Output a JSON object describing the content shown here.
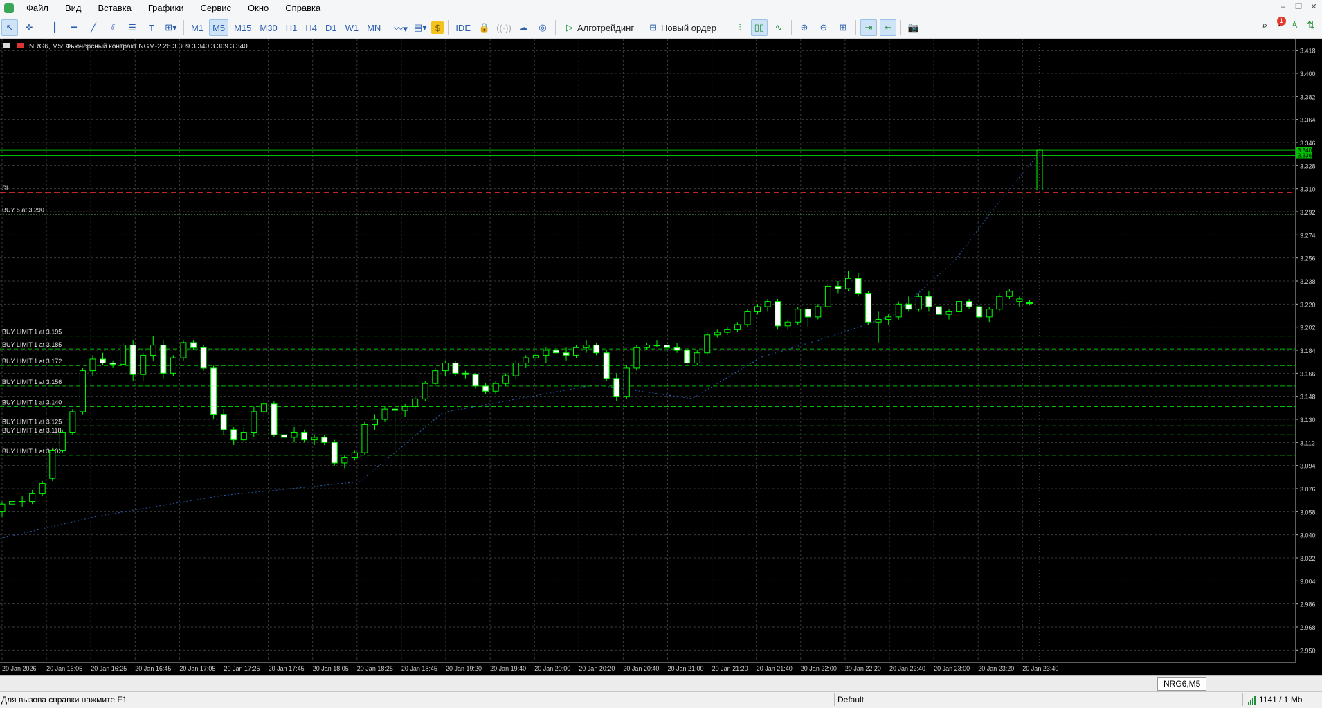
{
  "menu": [
    "Файл",
    "Вид",
    "Вставка",
    "Графики",
    "Сервис",
    "Окно",
    "Справка"
  ],
  "toolbar": {
    "timeframes": [
      "M1",
      "M5",
      "M15",
      "M30",
      "H1",
      "H4",
      "D1",
      "W1",
      "MN"
    ],
    "active_timeframe": "M5",
    "ide_label": "IDE",
    "algotrading_label": "Алготрейдинг",
    "new_order_label": "Новый ордер",
    "notification_count": "1"
  },
  "chart": {
    "header": "NRG6, M5:  Фьючерсный контракт NGM-2.26  3.309 3.340 3.309 3.340",
    "background": "#000000",
    "bull_color": "#00ff00",
    "bear_color": "#ffffff",
    "grid_color": "#3a3a3a",
    "level_color": "#00c000",
    "sl_color": "#ff3333",
    "price_labels": [
      "3.418",
      "3.400",
      "3.382",
      "3.364",
      "3.346",
      "3.328",
      "3.310",
      "3.292",
      "3.274",
      "3.256",
      "3.238",
      "3.220",
      "3.202",
      "3.184",
      "3.166",
      "3.148",
      "3.130",
      "3.112",
      "3.094",
      "3.076",
      "3.058",
      "3.040",
      "3.022",
      "3.004",
      "2.986",
      "2.968",
      "2.950"
    ],
    "current_price_labels": [
      "3.340",
      "3.336"
    ],
    "time_labels": [
      "20 Jan 2026",
      "20 Jan 16:05",
      "20 Jan 16:25",
      "20 Jan 16:45",
      "20 Jan 17:05",
      "20 Jan 17:25",
      "20 Jan 17:45",
      "20 Jan 18:05",
      "20 Jan 18:25",
      "20 Jan 18:45",
      "20 Jan 19:20",
      "20 Jan 19:40",
      "20 Jan 20:00",
      "20 Jan 20:20",
      "20 Jan 20:40",
      "20 Jan 21:00",
      "20 Jan 21:20",
      "20 Jan 21:40",
      "20 Jan 22:00",
      "20 Jan 22:20",
      "20 Jan 22:40",
      "20 Jan 23:00",
      "20 Jan 23:20",
      "20 Jan 23:40"
    ],
    "levels": [
      {
        "label": "SL",
        "price": 3.307,
        "kind": "sl"
      },
      {
        "label": "BUY 5 at 3.290",
        "price": 3.29,
        "kind": "solid"
      },
      {
        "label": "BUY LIMIT 1 at 3.195",
        "price": 3.195,
        "kind": "limit"
      },
      {
        "label": "BUY LIMIT 1 at 3.185",
        "price": 3.185,
        "kind": "limit"
      },
      {
        "label": "BUY LIMIT 1 at 3.172",
        "price": 3.172,
        "kind": "limit"
      },
      {
        "label": "BUY LIMIT 1 at 3.156",
        "price": 3.156,
        "kind": "limit"
      },
      {
        "label": "BUY LIMIT 1 at 3.140",
        "price": 3.14,
        "kind": "limit"
      },
      {
        "label": "BUY LIMIT 1 at 3.125",
        "price": 3.125,
        "kind": "limit"
      },
      {
        "label": "BUY LIMIT 1 at 3.118",
        "price": 3.118,
        "kind": "limit"
      },
      {
        "label": "BUY LIMIT 1 at 3.102",
        "price": 3.102,
        "kind": "limit"
      }
    ],
    "current_levels": [
      3.34,
      3.336
    ],
    "chart_data": {
      "type": "candlestick",
      "symbol": "NRG6",
      "timeframe": "M5",
      "ylim": [
        2.941,
        3.427
      ],
      "candles": [
        [
          3.058,
          3.066,
          3.054,
          3.064
        ],
        [
          3.064,
          3.068,
          3.06,
          3.066
        ],
        [
          3.066,
          3.07,
          3.062,
          3.066
        ],
        [
          3.066,
          3.075,
          3.064,
          3.072
        ],
        [
          3.072,
          3.082,
          3.07,
          3.08
        ],
        [
          3.084,
          3.108,
          3.082,
          3.106
        ],
        [
          3.106,
          3.122,
          3.104,
          3.12
        ],
        [
          3.12,
          3.138,
          3.118,
          3.136
        ],
        [
          3.136,
          3.17,
          3.134,
          3.168
        ],
        [
          3.168,
          3.18,
          3.164,
          3.177
        ],
        [
          3.177,
          3.182,
          3.172,
          3.174
        ],
        [
          3.174,
          3.176,
          3.17,
          3.173
        ],
        [
          3.173,
          3.19,
          3.172,
          3.188
        ],
        [
          3.188,
          3.192,
          3.16,
          3.165
        ],
        [
          3.165,
          3.182,
          3.16,
          3.18
        ],
        [
          3.18,
          3.195,
          3.176,
          3.188
        ],
        [
          3.188,
          3.192,
          3.162,
          3.166
        ],
        [
          3.166,
          3.18,
          3.164,
          3.178
        ],
        [
          3.178,
          3.192,
          3.176,
          3.19
        ],
        [
          3.19,
          3.192,
          3.184,
          3.186
        ],
        [
          3.186,
          3.188,
          3.168,
          3.17
        ],
        [
          3.17,
          3.172,
          3.13,
          3.134
        ],
        [
          3.134,
          3.138,
          3.118,
          3.122
        ],
        [
          3.122,
          3.124,
          3.11,
          3.114
        ],
        [
          3.114,
          3.124,
          3.112,
          3.12
        ],
        [
          3.12,
          3.14,
          3.116,
          3.136
        ],
        [
          3.136,
          3.146,
          3.132,
          3.142
        ],
        [
          3.142,
          3.144,
          3.116,
          3.118
        ],
        [
          3.118,
          3.122,
          3.112,
          3.116
        ],
        [
          3.116,
          3.124,
          3.112,
          3.12
        ],
        [
          3.12,
          3.122,
          3.112,
          3.114
        ],
        [
          3.114,
          3.118,
          3.11,
          3.116
        ],
        [
          3.116,
          3.118,
          3.11,
          3.112
        ],
        [
          3.112,
          3.114,
          3.094,
          3.096
        ],
        [
          3.096,
          3.102,
          3.092,
          3.1
        ],
        [
          3.1,
          3.106,
          3.098,
          3.104
        ],
        [
          3.104,
          3.128,
          3.102,
          3.126
        ],
        [
          3.126,
          3.134,
          3.122,
          3.13
        ],
        [
          3.13,
          3.14,
          3.128,
          3.138
        ],
        [
          3.138,
          3.142,
          3.1,
          3.137
        ],
        [
          3.137,
          3.142,
          3.132,
          3.14
        ],
        [
          3.14,
          3.148,
          3.138,
          3.146
        ],
        [
          3.146,
          3.16,
          3.144,
          3.158
        ],
        [
          3.158,
          3.17,
          3.156,
          3.168
        ],
        [
          3.168,
          3.176,
          3.164,
          3.174
        ],
        [
          3.174,
          3.176,
          3.164,
          3.166
        ],
        [
          3.166,
          3.168,
          3.162,
          3.165
        ],
        [
          3.165,
          3.166,
          3.154,
          3.156
        ],
        [
          3.156,
          3.158,
          3.15,
          3.152
        ],
        [
          3.152,
          3.16,
          3.15,
          3.158
        ],
        [
          3.158,
          3.166,
          3.156,
          3.164
        ],
        [
          3.164,
          3.176,
          3.162,
          3.174
        ],
        [
          3.174,
          3.18,
          3.17,
          3.178
        ],
        [
          3.178,
          3.182,
          3.176,
          3.18
        ],
        [
          3.18,
          3.186,
          3.174,
          3.184
        ],
        [
          3.184,
          3.188,
          3.18,
          3.182
        ],
        [
          3.182,
          3.186,
          3.176,
          3.18
        ],
        [
          3.18,
          3.188,
          3.178,
          3.186
        ],
        [
          3.186,
          3.192,
          3.182,
          3.188
        ],
        [
          3.188,
          3.19,
          3.18,
          3.182
        ],
        [
          3.182,
          3.184,
          3.16,
          3.162
        ],
        [
          3.162,
          3.166,
          3.144,
          3.148
        ],
        [
          3.148,
          3.172,
          3.146,
          3.17
        ],
        [
          3.17,
          3.188,
          3.168,
          3.186
        ],
        [
          3.186,
          3.19,
          3.184,
          3.188
        ],
        [
          3.188,
          3.192,
          3.186,
          3.188
        ],
        [
          3.188,
          3.19,
          3.184,
          3.186
        ],
        [
          3.186,
          3.19,
          3.182,
          3.184
        ],
        [
          3.184,
          3.186,
          3.172,
          3.174
        ],
        [
          3.174,
          3.184,
          3.172,
          3.182
        ],
        [
          3.182,
          3.198,
          3.18,
          3.196
        ],
        [
          3.196,
          3.2,
          3.194,
          3.198
        ],
        [
          3.198,
          3.202,
          3.196,
          3.2
        ],
        [
          3.2,
          3.206,
          3.198,
          3.204
        ],
        [
          3.204,
          3.216,
          3.202,
          3.214
        ],
        [
          3.214,
          3.22,
          3.212,
          3.218
        ],
        [
          3.218,
          3.224,
          3.214,
          3.222
        ],
        [
          3.222,
          3.224,
          3.2,
          3.203
        ],
        [
          3.203,
          3.208,
          3.2,
          3.206
        ],
        [
          3.206,
          3.218,
          3.204,
          3.216
        ],
        [
          3.216,
          3.218,
          3.202,
          3.21
        ],
        [
          3.21,
          3.22,
          3.208,
          3.218
        ],
        [
          3.218,
          3.236,
          3.216,
          3.234
        ],
        [
          3.234,
          3.238,
          3.228,
          3.232
        ],
        [
          3.232,
          3.246,
          3.23,
          3.24
        ],
        [
          3.24,
          3.244,
          3.226,
          3.228
        ],
        [
          3.228,
          3.23,
          3.204,
          3.206
        ],
        [
          3.206,
          3.214,
          3.19,
          3.208
        ],
        [
          3.208,
          3.212,
          3.204,
          3.21
        ],
        [
          3.21,
          3.222,
          3.208,
          3.22
        ],
        [
          3.22,
          3.226,
          3.214,
          3.216
        ],
        [
          3.216,
          3.228,
          3.214,
          3.226
        ],
        [
          3.226,
          3.23,
          3.214,
          3.218
        ],
        [
          3.218,
          3.222,
          3.21,
          3.212
        ],
        [
          3.212,
          3.216,
          3.208,
          3.214
        ],
        [
          3.214,
          3.224,
          3.212,
          3.222
        ],
        [
          3.222,
          3.224,
          3.216,
          3.218
        ],
        [
          3.218,
          3.22,
          3.208,
          3.21
        ],
        [
          3.21,
          3.218,
          3.206,
          3.216
        ],
        [
          3.216,
          3.228,
          3.214,
          3.226
        ],
        [
          3.226,
          3.232,
          3.224,
          3.23
        ],
        [
          3.222,
          3.226,
          3.218,
          3.224
        ],
        [
          3.221,
          3.223,
          3.219,
          3.221
        ],
        [
          3.309,
          3.34,
          3.309,
          3.34
        ]
      ]
    }
  },
  "tab": {
    "label": "NRG6,M5"
  },
  "status": {
    "help": "Для вызова справки нажмите F1",
    "profile": "Default",
    "traffic": "1141 / 1 Mb"
  }
}
